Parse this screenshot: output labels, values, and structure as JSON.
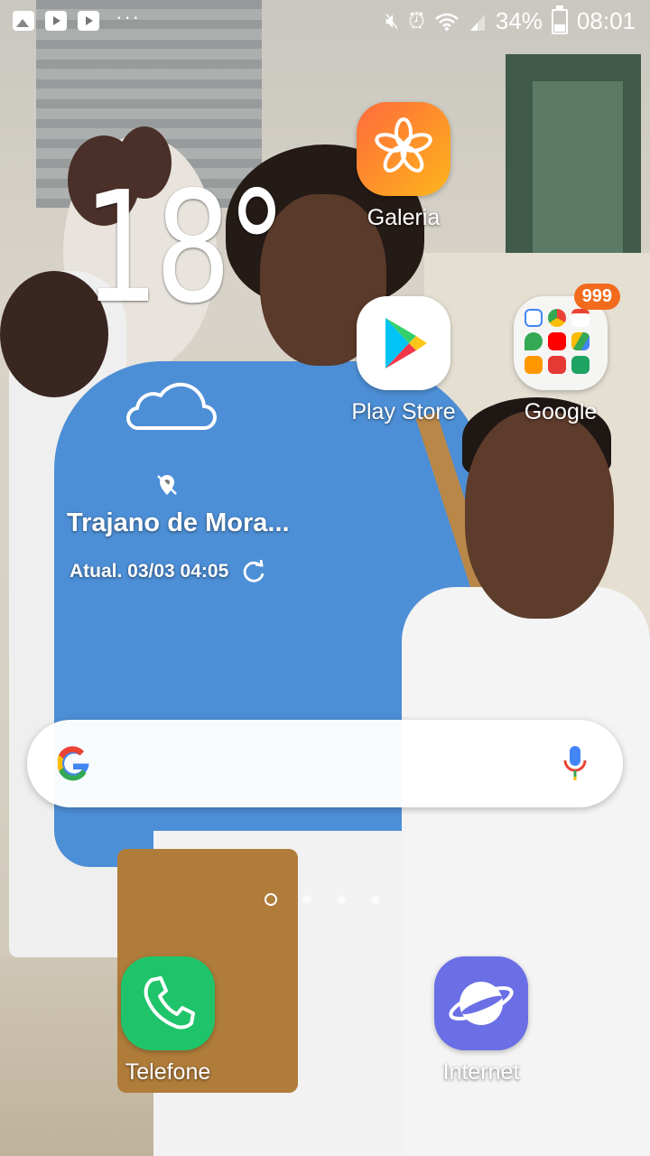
{
  "status_bar": {
    "notification_icons": [
      "gallery-icon",
      "youtube-icon",
      "youtube-icon",
      "more-dots-icon"
    ],
    "system_icons": [
      "mute-icon",
      "alarm-icon",
      "wifi-icon",
      "signal-icon"
    ],
    "battery": "34%",
    "time": "08:01"
  },
  "weather": {
    "temperature": "18°",
    "condition_icon": "cloud-icon",
    "location": "Trajano de Mora...",
    "updated": "Atual. 03/03 04:05"
  },
  "apps": {
    "galeria": {
      "label": "Galeria",
      "color": "#f89a1c"
    },
    "play_store": {
      "label": "Play Store"
    },
    "google_folder": {
      "label": "Google",
      "badge": "999"
    },
    "telefone": {
      "label": "Telefone",
      "color": "#1fc46a"
    },
    "internet": {
      "label": "Internet",
      "color": "#6b6fe6"
    }
  },
  "search": {
    "logo": "google-logo",
    "mic_icon": "mic-icon"
  },
  "pager": {
    "pages": 4,
    "active": 0
  }
}
